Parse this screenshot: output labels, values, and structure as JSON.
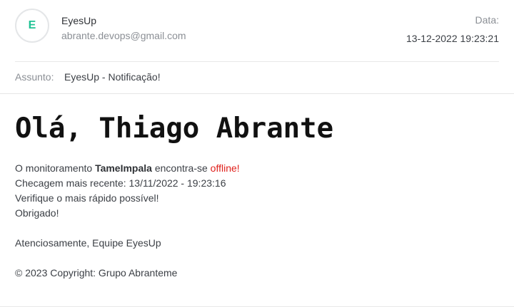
{
  "header": {
    "avatar_initial": "E",
    "sender_name": "EyesUp",
    "sender_email": "abrante.devops@gmail.com",
    "date_label": "Data:",
    "date_value": "13-12-2022 19:23:21"
  },
  "subject": {
    "label": "Assunto:",
    "value": "EyesUp - Notificação!"
  },
  "message": {
    "greeting": "Olá, Thiago Abrante",
    "line1_prefix": "O monitoramento ",
    "monitor_name": "TameImpala",
    "line1_middle": " encontra-se ",
    "status": "offline!",
    "line2": "Checagem mais recente: 13/11/2022 - 19:23:16",
    "line3": "Verifique o mais rápido possível!",
    "line4": "Obrigado!",
    "signature": "Atenciosamente, Equipe EyesUp",
    "copyright": "© 2023 Copyright: Grupo Abranteme"
  },
  "colors": {
    "avatar_initial": "#1fc294",
    "status_offline": "#e0201b"
  }
}
